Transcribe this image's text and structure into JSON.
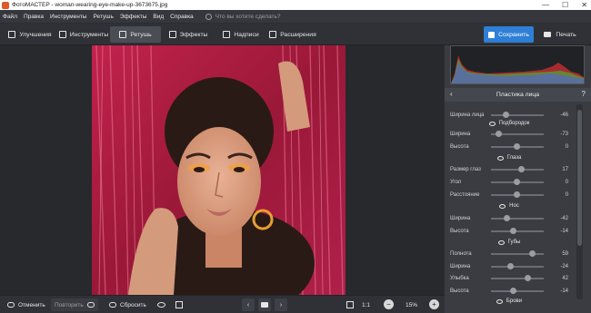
{
  "app": {
    "title": "ФотоМАСТЕР - woman-wearing-eye-make-up-3673675.jpg"
  },
  "window_controls": {
    "minimize": "—",
    "maximize": "☐",
    "close": "✕"
  },
  "menu": {
    "items": [
      "Файл",
      "Правка",
      "Инструменты",
      "Ретушь",
      "Эффекты",
      "Вид",
      "Справка"
    ],
    "search_placeholder": "Что вы хотите сделать?"
  },
  "toolbar": {
    "tabs": [
      {
        "label": "Улучшения",
        "icon": "sliders-icon",
        "active": false
      },
      {
        "label": "Инструменты",
        "icon": "crop-icon",
        "active": false
      },
      {
        "label": "Ретушь",
        "icon": "brush-icon",
        "active": true
      },
      {
        "label": "Эффекты",
        "icon": "magic-wand-icon",
        "active": false
      },
      {
        "label": "Надписи",
        "icon": "text-icon",
        "active": false
      },
      {
        "label": "Расширения",
        "icon": "plus-icon",
        "active": false
      }
    ],
    "save_label": "Сохранить",
    "print_label": "Печать"
  },
  "panel": {
    "title": "Пластика лица",
    "back_icon": "‹",
    "help_icon": "?",
    "groups": [
      {
        "header": "",
        "sliders": [
          {
            "label": "Ширина лица",
            "value": "-46",
            "level": 0.27
          }
        ]
      },
      {
        "header": "Подбородок",
        "icon": "chin-icon",
        "sliders": [
          {
            "label": "Ширина",
            "value": "-73",
            "level": 0.14
          },
          {
            "label": "Высота",
            "value": "0",
            "level": 0.5
          }
        ]
      },
      {
        "header": "Глаза",
        "icon": "eye-icon",
        "sliders": [
          {
            "label": "Размер глаз",
            "value": "17",
            "level": 0.58
          },
          {
            "label": "Угол",
            "value": "0",
            "level": 0.5
          },
          {
            "label": "Расстояние",
            "value": "0",
            "level": 0.5
          }
        ]
      },
      {
        "header": "Нос",
        "icon": "nose-icon",
        "sliders": [
          {
            "label": "Ширина",
            "value": "-42",
            "level": 0.29
          },
          {
            "label": "Высота",
            "value": "-14",
            "level": 0.43
          }
        ]
      },
      {
        "header": "Губы",
        "icon": "lips-icon",
        "sliders": [
          {
            "label": "Полнота",
            "value": "59",
            "level": 0.79
          },
          {
            "label": "Ширина",
            "value": "-24",
            "level": 0.38
          },
          {
            "label": "Улыбка",
            "value": "42",
            "level": 0.71
          },
          {
            "label": "Высота",
            "value": "-14",
            "level": 0.43
          }
        ]
      },
      {
        "header": "Брови",
        "icon": "brow-icon",
        "sliders": []
      }
    ]
  },
  "bottom": {
    "undo_label": "Отменить",
    "redo_label": "Повторить",
    "reset_label": "Сбросить",
    "ratio_label": "1:1",
    "zoom_value": "15%",
    "zoom_minus": "−",
    "zoom_plus": "+",
    "prev_icon": "‹",
    "next_icon": "›"
  },
  "colors": {
    "accent": "#2e7fd6",
    "background": "#2b2d31",
    "panel": "#3a3c41"
  }
}
